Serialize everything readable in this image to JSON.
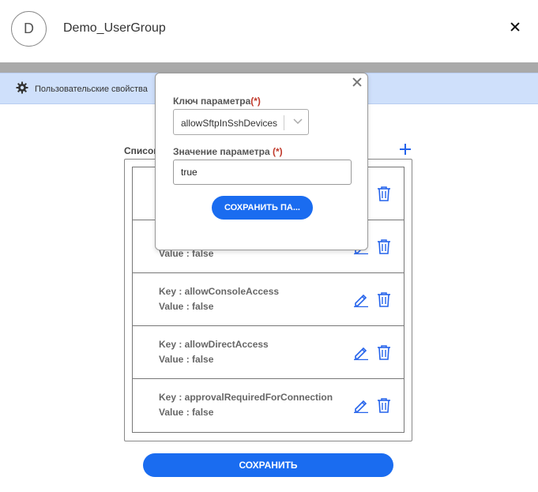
{
  "header": {
    "avatar_letter": "D",
    "title": "Demo_UserGroup"
  },
  "tab": {
    "label": "Пользовательские свойства"
  },
  "list": {
    "label": "Список",
    "rows": [
      {
        "key": "",
        "value": ""
      },
      {
        "key": "",
        "value": "Value : false"
      },
      {
        "key": "Key : allowConsoleAccess",
        "value": "Value : false"
      },
      {
        "key": "Key : allowDirectAccess",
        "value": "Value : false"
      },
      {
        "key": "Key : approvalRequiredForConnection",
        "value": "Value : false"
      }
    ]
  },
  "save_button": "СОХРАНИТЬ",
  "popup": {
    "key_label": "Ключ параметра",
    "value_label": "Значение параметра ",
    "required_mark": "(*)",
    "key_selected": "allowSftpInSshDevices",
    "value_input": "true",
    "save_label": "СОХРАНИТЬ ПА..."
  },
  "colors": {
    "accent": "#1a6cf0",
    "tabbar": "#cfe0fb",
    "required": "#c0392b"
  }
}
